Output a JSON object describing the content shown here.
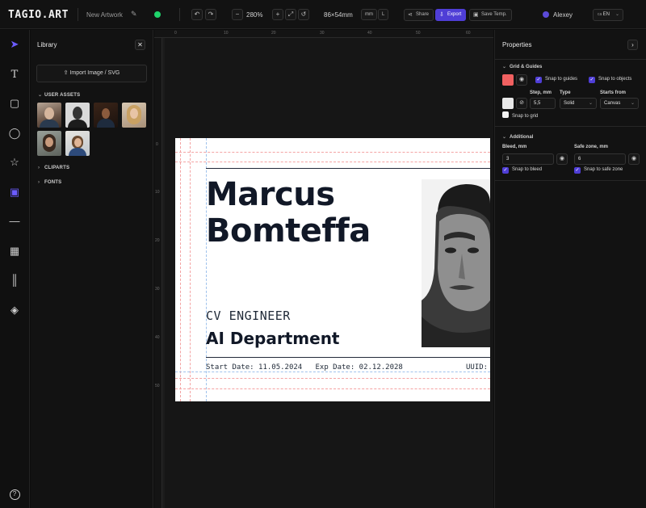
{
  "app": {
    "logo": "TAGIO.ART",
    "artwork_name": "New Artwork",
    "zoom": "280%",
    "size": "86×54mm",
    "unit": "mm",
    "orientation": "L",
    "share_label": "Share",
    "export_label": "Export",
    "save_template_label": "Save Temp.",
    "user_name": "Alexey",
    "language": "EN",
    "status_color": "#1fd36b",
    "accent_color": "#4f3ed6"
  },
  "toolbar": {
    "tools": [
      {
        "name": "select-tool",
        "icon": "cursor-icon",
        "glyph": "➤"
      },
      {
        "name": "text-tool",
        "icon": "text-icon",
        "glyph": "T"
      },
      {
        "name": "rectangle-tool",
        "icon": "square-icon",
        "glyph": "▢"
      },
      {
        "name": "ellipse-tool",
        "icon": "circle-icon",
        "glyph": "◯"
      },
      {
        "name": "star-tool",
        "icon": "star-icon",
        "glyph": "☆"
      },
      {
        "name": "image-tool",
        "icon": "image-icon",
        "glyph": "▣"
      },
      {
        "name": "line-tool",
        "icon": "line-icon",
        "glyph": "—"
      },
      {
        "name": "qr-tool",
        "icon": "qr-code-icon",
        "glyph": "▦"
      },
      {
        "name": "barcode-tool",
        "icon": "barcode-icon",
        "glyph": "║"
      },
      {
        "name": "layers-tool",
        "icon": "layers-icon",
        "glyph": "◈"
      },
      {
        "name": "help-tool",
        "icon": "help-icon",
        "glyph": "?"
      }
    ]
  },
  "library": {
    "title": "Library",
    "import_label": "Import Image / SVG",
    "user_assets_label": "USER ASSETS",
    "cliparts_label": "CLIPARTS",
    "fonts_label": "FONTS"
  },
  "ruler": {
    "top_ticks": [
      "0",
      "10",
      "20",
      "30",
      "40",
      "50",
      "60"
    ],
    "left_ticks": [
      "0",
      "10",
      "20",
      "30",
      "40",
      "50"
    ]
  },
  "card": {
    "name_line1": "Marcus",
    "name_line2": "Bomteffa",
    "role": "CV ENGINEER",
    "department": "AI Department",
    "start_date": "Start Date: 11.05.2024",
    "exp_date": "Exp Date: 02.12.2028",
    "uuid_label": "UUID:"
  },
  "properties": {
    "title": "Properties",
    "grid_section": "Grid & Guides",
    "guide_color": "#f06060",
    "grid_color": "#e8e8e8",
    "snap_to_guides": "Snap to guides",
    "snap_to_objects": "Snap to objects",
    "step_label": "Step, mm",
    "step_value": "5,5",
    "type_label": "Type",
    "type_value": "Solid",
    "starts_from_label": "Starts from",
    "starts_from_value": "Canvas",
    "snap_to_grid": "Snap to grid",
    "additional_section": "Additional",
    "bleed_label": "Bleed, mm",
    "bleed_value": "3",
    "safe_zone_label": "Safe zone, mm",
    "safe_zone_value": "6",
    "snap_to_bleed": "Snap to bleed",
    "snap_to_safe_zone": "Snap to safe zone"
  }
}
